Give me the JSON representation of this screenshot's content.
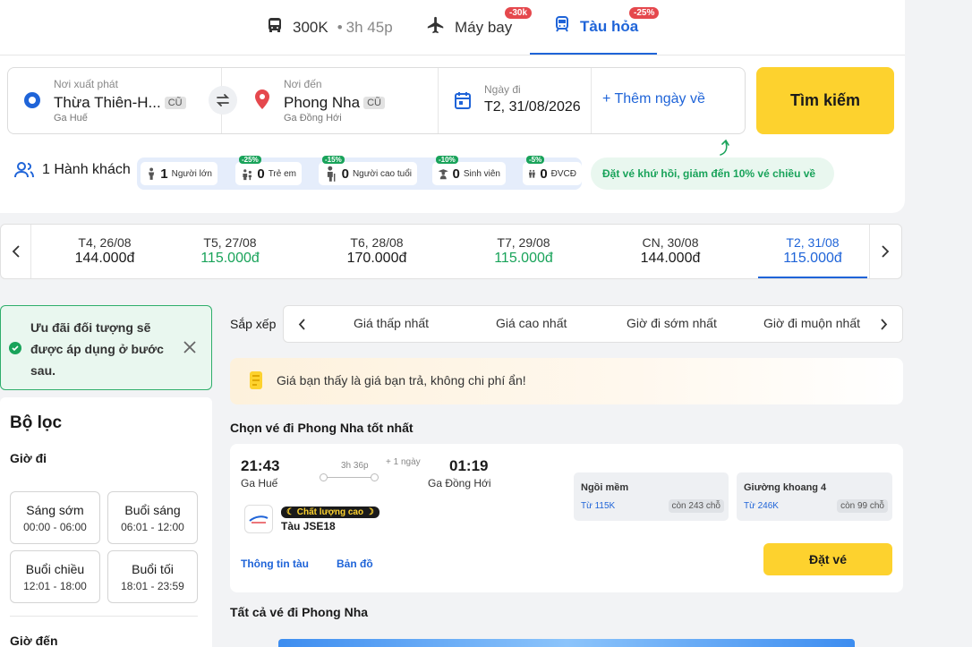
{
  "modes": {
    "bus": {
      "label": "300K",
      "sep": "•",
      "duration": "3h 45p"
    },
    "plane": {
      "label": "Máy bay",
      "badge": "-30k"
    },
    "train": {
      "label": "Tàu hỏa",
      "badge": "-25%"
    }
  },
  "search": {
    "origin": {
      "label": "Nơi xuất phát",
      "value": "Thừa Thiên-H...",
      "code": "CŨ",
      "station": "Ga Huế"
    },
    "destination": {
      "label": "Nơi đến",
      "value": "Phong Nha",
      "code": "CŨ",
      "station": "Ga Đồng Hới"
    },
    "date": {
      "label": "Ngày đi",
      "value": "T2, 31/08/2026"
    },
    "return_label": "+ Thêm ngày về",
    "button": "Tìm kiếm"
  },
  "passengers": {
    "summary": "1 Hành khách",
    "types": [
      {
        "count": "1",
        "name": "Người lớn",
        "discount": ""
      },
      {
        "count": "0",
        "name": "Trẻ em",
        "discount": "-25%"
      },
      {
        "count": "0",
        "name": "Người cao tuổi",
        "discount": "-15%"
      },
      {
        "count": "0",
        "name": "Sinh viên",
        "discount": "-10%"
      },
      {
        "count": "0",
        "name": "ĐVCĐ",
        "discount": "-5%"
      }
    ],
    "promo": "Đặt vé khứ hồi, giảm đến 10% vé chiều về"
  },
  "dates": [
    {
      "day": "T4, 26/08",
      "price": "144.000đ"
    },
    {
      "day": "T5, 27/08",
      "price": "115.000đ"
    },
    {
      "day": "T6, 28/08",
      "price": "170.000đ"
    },
    {
      "day": "T7, 29/08",
      "price": "115.000đ"
    },
    {
      "day": "CN, 30/08",
      "price": "144.000đ"
    },
    {
      "day": "T2, 31/08",
      "price": "115.000đ"
    }
  ],
  "offer": "Ưu đãi đối tượng sẽ được áp dụng ở bước sau.",
  "filter": {
    "title": "Bộ lọc",
    "depart_label": "Giờ đi",
    "arrive_label": "Giờ đến",
    "slots": [
      {
        "name": "Sáng sớm",
        "range": "00:00 - 06:00"
      },
      {
        "name": "Buổi sáng",
        "range": "06:01 - 12:00"
      },
      {
        "name": "Buổi chiều",
        "range": "12:01 - 18:00"
      },
      {
        "name": "Buổi tối",
        "range": "18:01 - 23:59"
      }
    ]
  },
  "sort": {
    "label": "Sắp xếp",
    "options": [
      "Giá thấp nhất",
      "Giá cao nhất",
      "Giờ đi sớm nhất",
      "Giờ đi muộn nhất"
    ]
  },
  "notice": "Giá bạn thấy là giá bạn trả, không chi phí ẩn!",
  "best_title": "Chọn vé đi Phong Nha tốt nhất",
  "all_title": "Tất cả vé đi Phong Nha",
  "ticket": {
    "depart_time": "21:43",
    "depart_station": "Ga Huế",
    "duration": "3h 36p",
    "plus_day": "+ 1 ngày",
    "arrive_time": "01:19",
    "arrive_station": "Ga Đồng Hới",
    "quality": "Chất lượng cao",
    "train": "Tàu JSE18",
    "info_link": "Thông tin tàu",
    "map_link": "Bản đồ",
    "seats": [
      {
        "name": "Ngồi mềm",
        "from": "Từ 115K",
        "remain": "còn 243 chỗ"
      },
      {
        "name": "Giường khoang 4",
        "from": "Từ 246K",
        "remain": "còn 99 chỗ"
      }
    ],
    "book": "Đặt vé"
  }
}
